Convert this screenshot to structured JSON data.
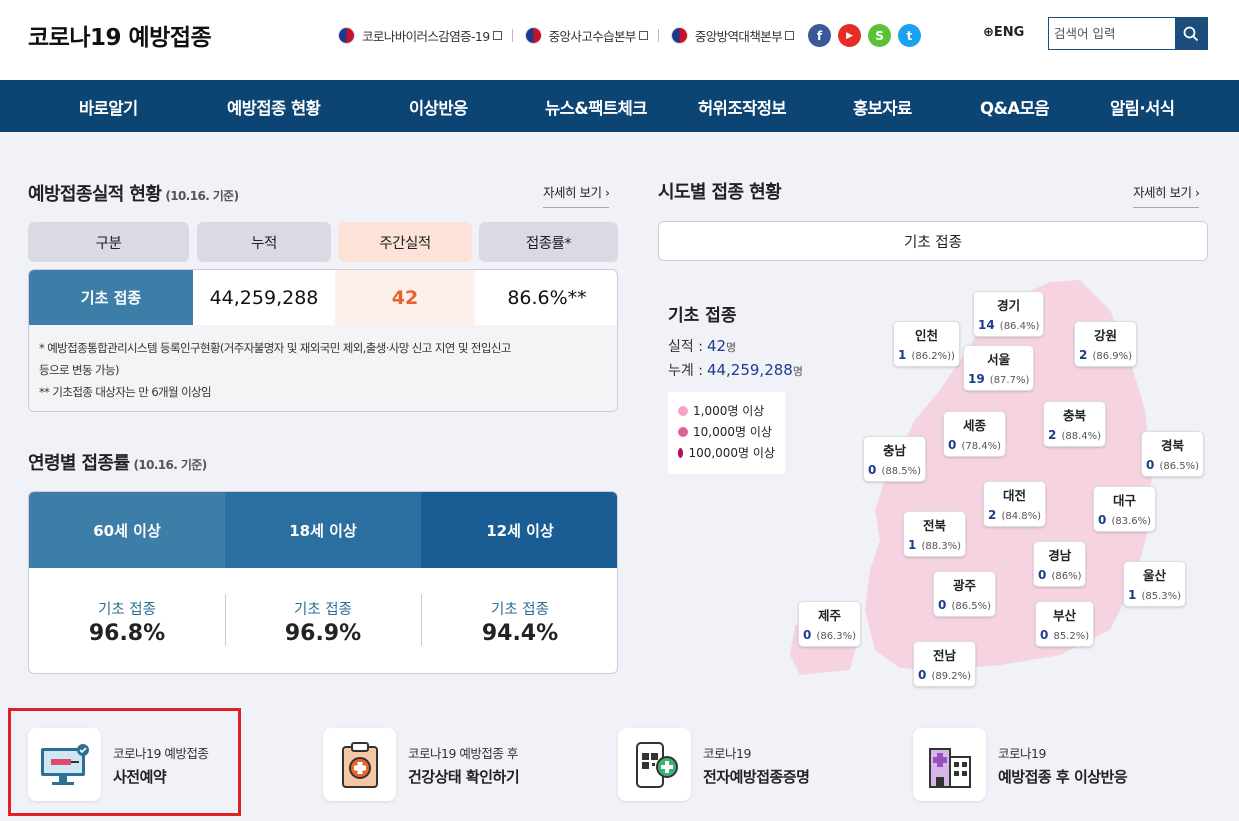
{
  "header": {
    "logo": "코로나19 예방접종",
    "top_links": [
      {
        "label": "코로나바이러스감염증-19"
      },
      {
        "label": "중앙사고수습본부"
      },
      {
        "label": "중앙방역대책본부"
      }
    ],
    "sns": [
      {
        "icon": "facebook-icon",
        "glyph": "f",
        "color": "#3b5998"
      },
      {
        "icon": "youtube-icon",
        "glyph": "▶",
        "color": "#e52d27"
      },
      {
        "icon": "kakao-story-icon",
        "glyph": "S",
        "color": "#5bc236"
      },
      {
        "icon": "twitter-icon",
        "glyph": "t",
        "color": "#1da1f2"
      }
    ],
    "lang": "ENG",
    "search_placeholder": "검색어 입력"
  },
  "nav": [
    "바로알기",
    "예방접종 현황",
    "이상반응",
    "뉴스&팩트체크",
    "허위조작정보",
    "홍보자료",
    "Q&A모음",
    "알림·서식"
  ],
  "performance": {
    "title": "예방접종실적 현황",
    "date": "(10.16. 기준)",
    "more": "자세히 보기",
    "headers": [
      "구분",
      "누적",
      "주간실적",
      "접종률*"
    ],
    "row": {
      "label": "기초 접종",
      "cumulative": "44,259,288",
      "weekly": "42",
      "rate": "86.6%**"
    },
    "notes": [
      "* 예방접종통합관리시스템 등록인구현황(거주자불명자 및 재외국민 제외,출생·사망 신고 지연 및 전입신고",
      "등으로 변동 가능)",
      "** 기초접종 대상자는 만 6개월 이상임"
    ]
  },
  "age": {
    "title": "연령별 접종률",
    "date": "(10.16. 기준)",
    "groups": [
      {
        "name": "60세 이상",
        "label": "기초 접종",
        "pct": "96.8%",
        "color": "#3d7ea8"
      },
      {
        "name": "18세 이상",
        "label": "기초 접종",
        "pct": "96.9%",
        "color": "#2b6fa0"
      },
      {
        "name": "12세 이상",
        "label": "기초 접종",
        "pct": "94.4%",
        "color": "#1a5d94"
      }
    ]
  },
  "region": {
    "title": "시도별 접종 현황",
    "more": "자세히 보기",
    "tab": "기초 접종",
    "stat_title": "기초 접종",
    "actual_label": "실적 :",
    "actual_value": "42",
    "total_label": "누계 :",
    "total_value": "44,259,288",
    "unit": "명",
    "legend": [
      {
        "label": "1,000명 이상",
        "color": "#f2a5c8"
      },
      {
        "label": "10,000명 이상",
        "color": "#e0609a"
      },
      {
        "label": "100,000명 이상",
        "color": "#b0125a"
      }
    ],
    "regions": [
      {
        "name": "경기",
        "value": "14",
        "pct": "(86.4%)"
      },
      {
        "name": "인천",
        "value": "1",
        "pct": "(86.2%))"
      },
      {
        "name": "강원",
        "value": "2",
        "pct": "(86.9%)"
      },
      {
        "name": "서울",
        "value": "19",
        "pct": "(87.7%)"
      },
      {
        "name": "세종",
        "value": "0",
        "pct": "(78.4%)"
      },
      {
        "name": "충북",
        "value": "2",
        "pct": "(88.4%)"
      },
      {
        "name": "충남",
        "value": "0",
        "pct": "(88.5%)"
      },
      {
        "name": "경북",
        "value": "0",
        "pct": "(86.5%)"
      },
      {
        "name": "대전",
        "value": "2",
        "pct": "(84.8%)"
      },
      {
        "name": "대구",
        "value": "0",
        "pct": "(83.6%)"
      },
      {
        "name": "전북",
        "value": "1",
        "pct": "(88.3%)"
      },
      {
        "name": "경남",
        "value": "0",
        "pct": "(86%)"
      },
      {
        "name": "울산",
        "value": "1",
        "pct": "(85.3%)"
      },
      {
        "name": "광주",
        "value": "0",
        "pct": "(86.5%)"
      },
      {
        "name": "제주",
        "value": "0",
        "pct": "(86.3%)"
      },
      {
        "name": "부산",
        "value": "0",
        "pct": "85.2%)"
      },
      {
        "name": "전남",
        "value": "0",
        "pct": "(89.2%)"
      }
    ]
  },
  "quick": [
    {
      "sub": "코로나19 예방접종",
      "main": "사전예약",
      "icon": "monitor-syringe-icon"
    },
    {
      "sub": "코로나19 예방접종 후",
      "main": "건강상태 확인하기",
      "icon": "clipboard-medical-icon"
    },
    {
      "sub": "코로나19",
      "main": "전자예방접종증명",
      "icon": "phone-qr-icon"
    },
    {
      "sub": "코로나19",
      "main": "예방접종 후 이상반응",
      "icon": "hospital-icon"
    }
  ]
}
